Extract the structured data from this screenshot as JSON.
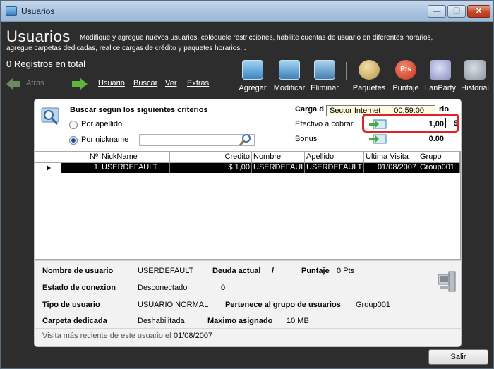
{
  "window": {
    "title": "Usuarios"
  },
  "header": {
    "title": "Usuarios",
    "description_line1": "Modifique y agregue nuevos usuarios, colóquele restricciones, habilite cuentas de usuario en diferentes horarios,",
    "description_line2": "agregue carpetas dedicadas, realice cargas de crédito y paquetes horarios...",
    "record_count": "0 Registros en total"
  },
  "nav": {
    "back_label": "Atras",
    "menu": [
      "Usuario",
      "Buscar",
      "Ver",
      "Extras"
    ]
  },
  "toolbar": {
    "agregar": "Agregar",
    "modificar": "Modificar",
    "eliminar": "Eliminar",
    "paquetes": "Paquetes",
    "puntaje": "Puntaje",
    "pts_badge": "Pts",
    "lanparty": "LanParty",
    "historial": "Historial"
  },
  "search": {
    "title": "Buscar segun los siguientes criterios",
    "option_apellido": "Por apellido",
    "option_nickname": "Por nickname",
    "selected": "nickname",
    "nickname_value": ""
  },
  "carga": {
    "label": "Carga d",
    "label_suffix": "rio",
    "tooltip_name": "Sector Internet",
    "tooltip_time": "00:59:00",
    "efectivo_label": "Efectivo a cobrar",
    "efectivo_value": "1,00",
    "currency": "$",
    "bonus_label": "Bonus",
    "bonus_value": "0.00"
  },
  "grid": {
    "columns": [
      "Nº",
      "NickName",
      "Credito",
      "Nombre",
      "Apellido",
      "Ultima Visita",
      "Grupo"
    ],
    "rows": [
      {
        "n": "1",
        "nickname": "USERDEFAULT",
        "credito": "$ 1,00",
        "nombre": "USERDEFAULT",
        "apellido": "USERDEFAULT",
        "ultima_visita": "01/08/2007",
        "grupo": "Group001"
      }
    ]
  },
  "details": {
    "nombre_label": "Nombre de usuario",
    "nombre_value": "USERDEFAULT",
    "deuda_label": "Deuda actual",
    "deuda_sep": "/",
    "puntaje_label": "Puntaje",
    "puntaje_value": "0 Pts",
    "estado_label": "Estado de conexion",
    "estado_value": "Desconectado",
    "deuda_value": "0",
    "tipo_label": "Tipo de usuario",
    "tipo_value": "USUARIO NORMAL",
    "grupo_label": "Pertenece al grupo de usuarios",
    "grupo_value": "Group001",
    "carpeta_label": "Carpeta dedicada",
    "carpeta_value": "Deshabilitada",
    "maximo_label": "Maximo asignado",
    "maximo_value": "10 MB",
    "visita_label": "Visita más reciente de este usuario el",
    "visita_value": "01/08/2007"
  },
  "buttons": {
    "salir": "Salir"
  },
  "colors": {
    "accent_red": "#e0222a",
    "window_bg": "#2d2d2d",
    "selection": "#000000"
  }
}
